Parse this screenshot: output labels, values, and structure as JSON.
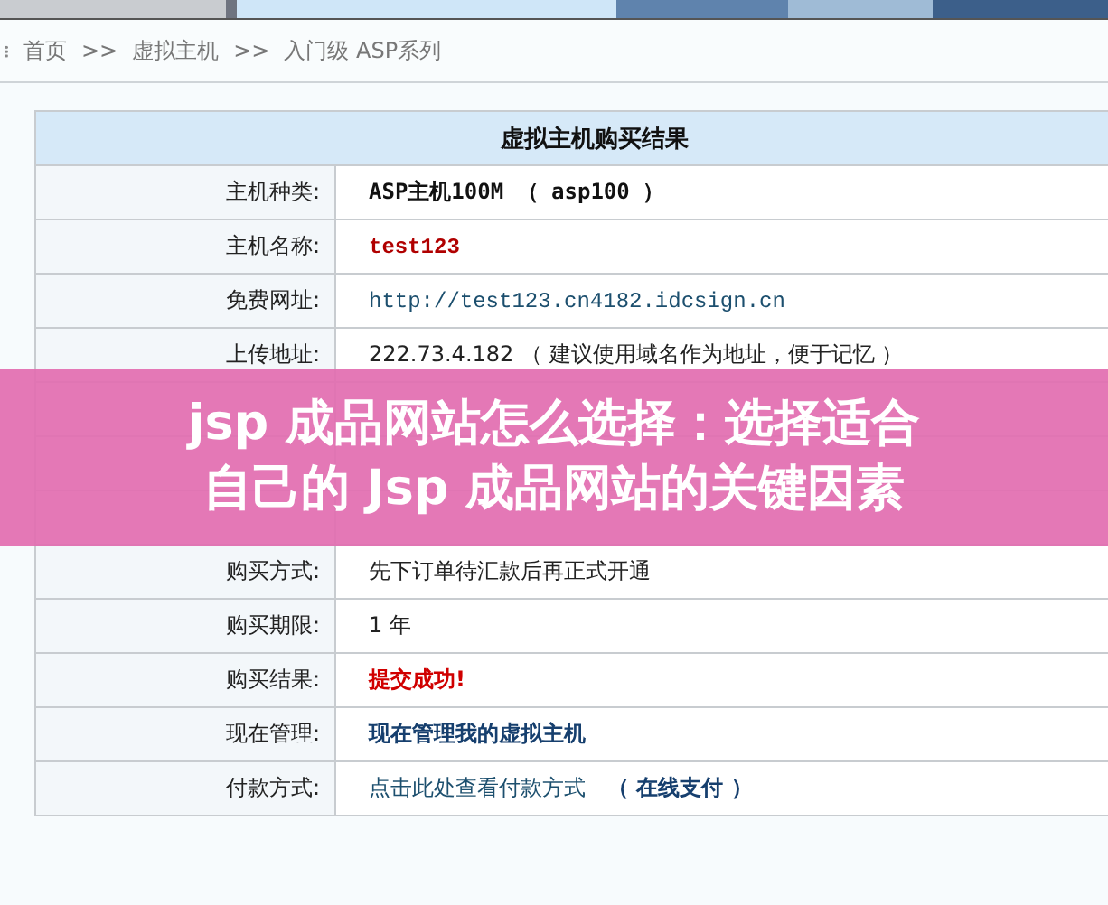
{
  "breadcrumb": [
    {
      "label": "首页"
    },
    {
      "label": "虚拟主机"
    },
    {
      "label": "入门级 ASP系列"
    }
  ],
  "breadcrumb_separator": ">>",
  "table": {
    "title": "虚拟主机购买结果",
    "rows": [
      {
        "kind": "bold",
        "label": "主机种类:",
        "value": "ASP主机100M （ asp100 ）"
      },
      {
        "kind": "name",
        "label": "主机名称:",
        "value": "test123"
      },
      {
        "kind": "link",
        "label": "免费网址:",
        "value": "http://test123.cn4182.idcsign.cn"
      },
      {
        "kind": "plain",
        "label": "上传地址:",
        "value": "222.73.4.182 （ 建议使用域名作为地址，便于记忆 ）"
      },
      {
        "kind": "covered"
      },
      {
        "kind": "covered"
      },
      {
        "kind": "covered"
      },
      {
        "kind": "plain",
        "label": "购买方式:",
        "value": "先下订单待汇款后再正式开通"
      },
      {
        "kind": "plain",
        "label": "购买期限:",
        "value": "1 年"
      },
      {
        "kind": "success",
        "label": "购买结果:",
        "value": "提交成功!"
      },
      {
        "kind": "manage",
        "label": "现在管理:",
        "value": "现在管理我的虚拟主机"
      },
      {
        "kind": "payment",
        "label": "付款方式:",
        "value": "点击此处查看付款方式",
        "extra": "（ 在线支付 ）"
      }
    ]
  },
  "banner": {
    "lines": [
      "jsp 成品网站怎么选择：选择适合",
      "自己的 Jsp 成品网站的关键因素"
    ]
  }
}
